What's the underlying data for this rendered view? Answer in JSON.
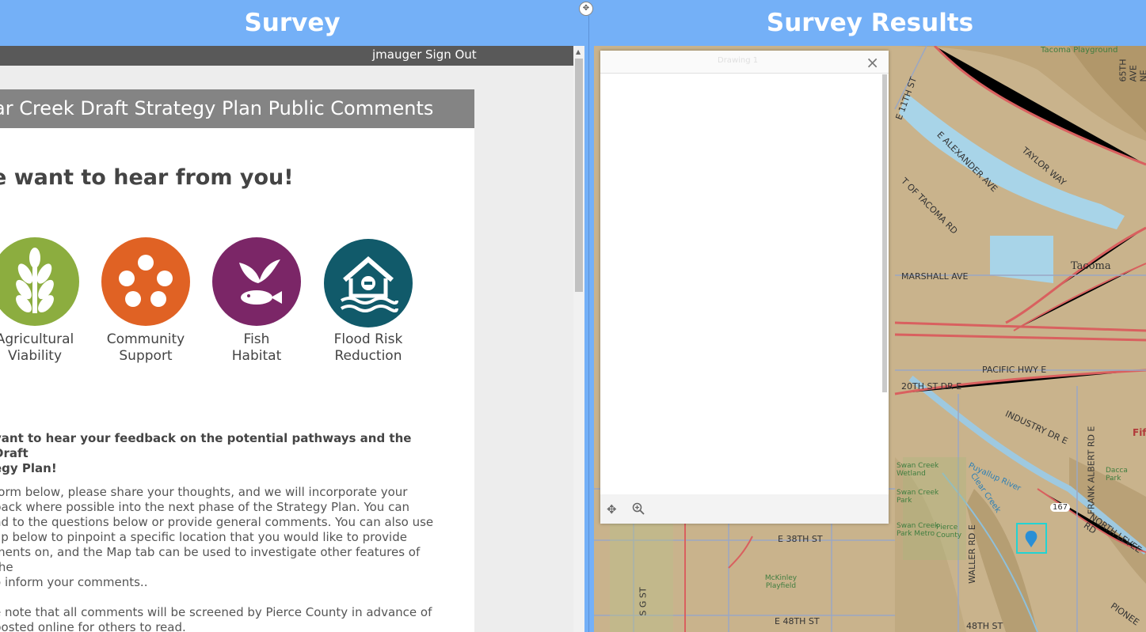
{
  "headers": {
    "left_title": "Survey",
    "right_title": "Survey Results"
  },
  "userbar": {
    "username": "jmauger",
    "signout": "Sign Out"
  },
  "form": {
    "title": "ar Creek Draft Strategy Plan Public Comments",
    "headline": "e want to hear from you!",
    "categories": [
      {
        "line1": "Agricultural",
        "line2": "Viability",
        "color": "#8cad3f",
        "icon": "wheat-icon"
      },
      {
        "line1": "Community",
        "line2": "Support",
        "color": "#e06224",
        "icon": "people-dots-icon"
      },
      {
        "line1": "Fish",
        "line2": "Habitat",
        "color": "#7b2667",
        "icon": "bird-fish-icon"
      },
      {
        "line1": "Flood Risk",
        "line2": "Reduction",
        "color": "#115a6a",
        "icon": "flooded-house-icon"
      }
    ],
    "intro_lines": [
      "vant to hear your feedback on the potential pathways and the Draft",
      "egy Plan!"
    ],
    "body_lines": [
      " form below, please share your thoughts, and we will incorporate your",
      "back where possible into the next phase of the Strategy Plan. You can",
      "nd to the questions below or provide general comments. You can also use",
      "ap below to pinpoint a specific location that you would like to provide",
      "ments on, and the Map tab can be used to investigate other features of the",
      "o inform your comments.."
    ],
    "note_lines": [
      "e note that all comments will be screened by Pierce County in advance of",
      "posted online for others to read."
    ]
  },
  "map": {
    "labels": [
      "Tacoma Playground",
      "65TH AVE NE",
      "E 11TH ST",
      "E ALEXANDER AVE",
      "TAYLOR WAY",
      "T OF TACOMA RD",
      "MARSHALL AVE",
      "Tacoma",
      "PACIFIC HWY E",
      "20TH ST DR E",
      "INDUSTRY DR E",
      "FRANK ALBERT RD E",
      "Puyallup River",
      "Clear Creek",
      "167",
      "NORTH LEVEE RD",
      "Swan Creek Wetland",
      "Swan Creek Park",
      "Swan Creek Park Metro",
      "Pierce County",
      "WALLER RD E",
      "E 38TH ST",
      "McKinley Playfield",
      "S G ST",
      "E 48TH ST",
      "48TH ST",
      "Dacca Park",
      "Fif",
      "PIONEE"
    ],
    "popup": {
      "title": "Drawing 1",
      "close": "×"
    }
  }
}
